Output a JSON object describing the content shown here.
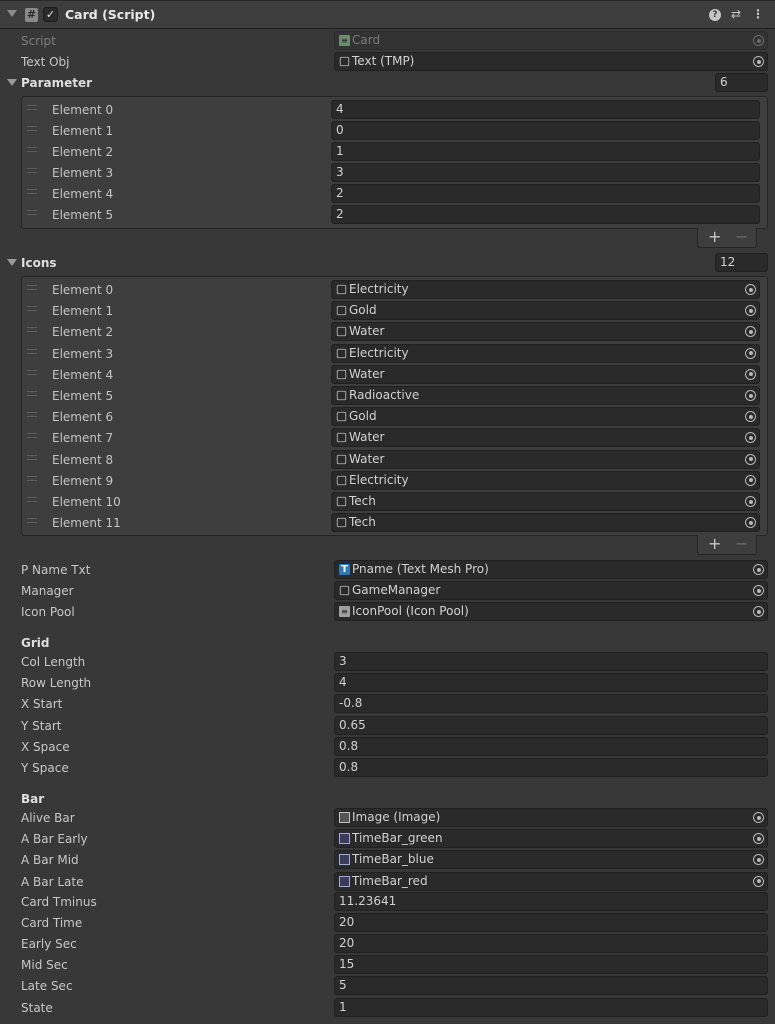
{
  "header": {
    "title": "Card (Script)",
    "help_icon": "help-icon",
    "preset_icon": "sliders-icon",
    "menu_icon": "kebab-menu-icon"
  },
  "fields_top": [
    {
      "label": "Script",
      "value": "Card",
      "icon": "script-icon",
      "disabled": true
    },
    {
      "label": "Text Obj",
      "value": "Text (TMP)",
      "icon": "cube-icon"
    }
  ],
  "parameter": {
    "label": "Parameter",
    "size": "6",
    "elements": [
      {
        "label": "Element 0",
        "value": "4"
      },
      {
        "label": "Element 1",
        "value": "0"
      },
      {
        "label": "Element 2",
        "value": "1"
      },
      {
        "label": "Element 3",
        "value": "3"
      },
      {
        "label": "Element 4",
        "value": "2"
      },
      {
        "label": "Element 5",
        "value": "2"
      }
    ],
    "add": "+",
    "remove": "−"
  },
  "icons": {
    "label": "Icons",
    "size": "12",
    "elements": [
      {
        "label": "Element 0",
        "value": "Electricity"
      },
      {
        "label": "Element 1",
        "value": "Gold"
      },
      {
        "label": "Element 2",
        "value": "Water"
      },
      {
        "label": "Element 3",
        "value": "Electricity"
      },
      {
        "label": "Element 4",
        "value": "Water"
      },
      {
        "label": "Element 5",
        "value": "Radioactive"
      },
      {
        "label": "Element 6",
        "value": "Gold"
      },
      {
        "label": "Element 7",
        "value": "Water"
      },
      {
        "label": "Element 8",
        "value": "Water"
      },
      {
        "label": "Element 9",
        "value": "Electricity"
      },
      {
        "label": "Element 10",
        "value": "Tech"
      },
      {
        "label": "Element 11",
        "value": "Tech"
      }
    ],
    "add": "+",
    "remove": "−"
  },
  "refs": [
    {
      "label": "P Name Txt",
      "value": "Pname (Text Mesh Pro)",
      "icon": "textmeshpro-icon"
    },
    {
      "label": "Manager",
      "value": "GameManager",
      "icon": "cube-icon"
    },
    {
      "label": "Icon Pool",
      "value": "IconPool (Icon Pool)",
      "icon": "script-icon"
    }
  ],
  "grid": {
    "header": "Grid",
    "fields": [
      {
        "label": "Col Length",
        "value": "3"
      },
      {
        "label": "Row Length",
        "value": "4"
      },
      {
        "label": "X Start",
        "value": "-0.8"
      },
      {
        "label": "Y Start",
        "value": "0.65"
      },
      {
        "label": "X Space",
        "value": "0.8"
      },
      {
        "label": "Y Space",
        "value": "0.8"
      }
    ]
  },
  "bar": {
    "header": "Bar",
    "objects": [
      {
        "label": "Alive Bar",
        "value": "Image (Image)",
        "icon": "image-icon"
      },
      {
        "label": "A Bar Early",
        "value": "TimeBar_green",
        "icon": "sprite-icon"
      },
      {
        "label": "A Bar Mid",
        "value": "TimeBar_blue",
        "icon": "sprite-icon"
      },
      {
        "label": "A Bar Late",
        "value": "TimeBar_red",
        "icon": "sprite-icon"
      }
    ],
    "fields": [
      {
        "label": "Card Tminus",
        "value": "11.23641"
      },
      {
        "label": "Card Time",
        "value": "20"
      },
      {
        "label": "Early Sec",
        "value": "20"
      },
      {
        "label": "Mid Sec",
        "value": "15"
      },
      {
        "label": "Late Sec",
        "value": "5"
      },
      {
        "label": "State",
        "value": "1"
      }
    ]
  }
}
